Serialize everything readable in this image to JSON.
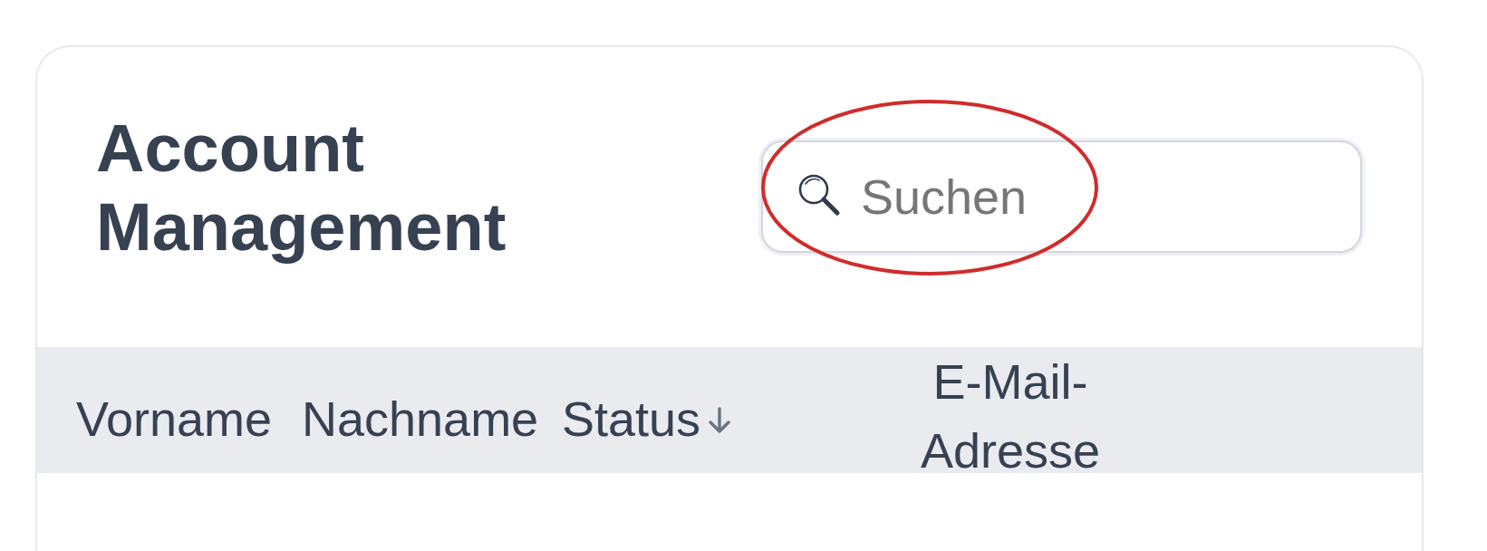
{
  "card": {
    "title": "Account Management"
  },
  "search": {
    "placeholder": "Suchen",
    "highlighted": true
  },
  "table": {
    "columns": [
      {
        "label": "Vorname",
        "sort_descending": false
      },
      {
        "label": "Nachname",
        "sort_descending": false
      },
      {
        "label": "Status",
        "sort_descending": true
      },
      {
        "label": "E-Mail-Adresse",
        "sort_descending": false
      }
    ]
  }
}
